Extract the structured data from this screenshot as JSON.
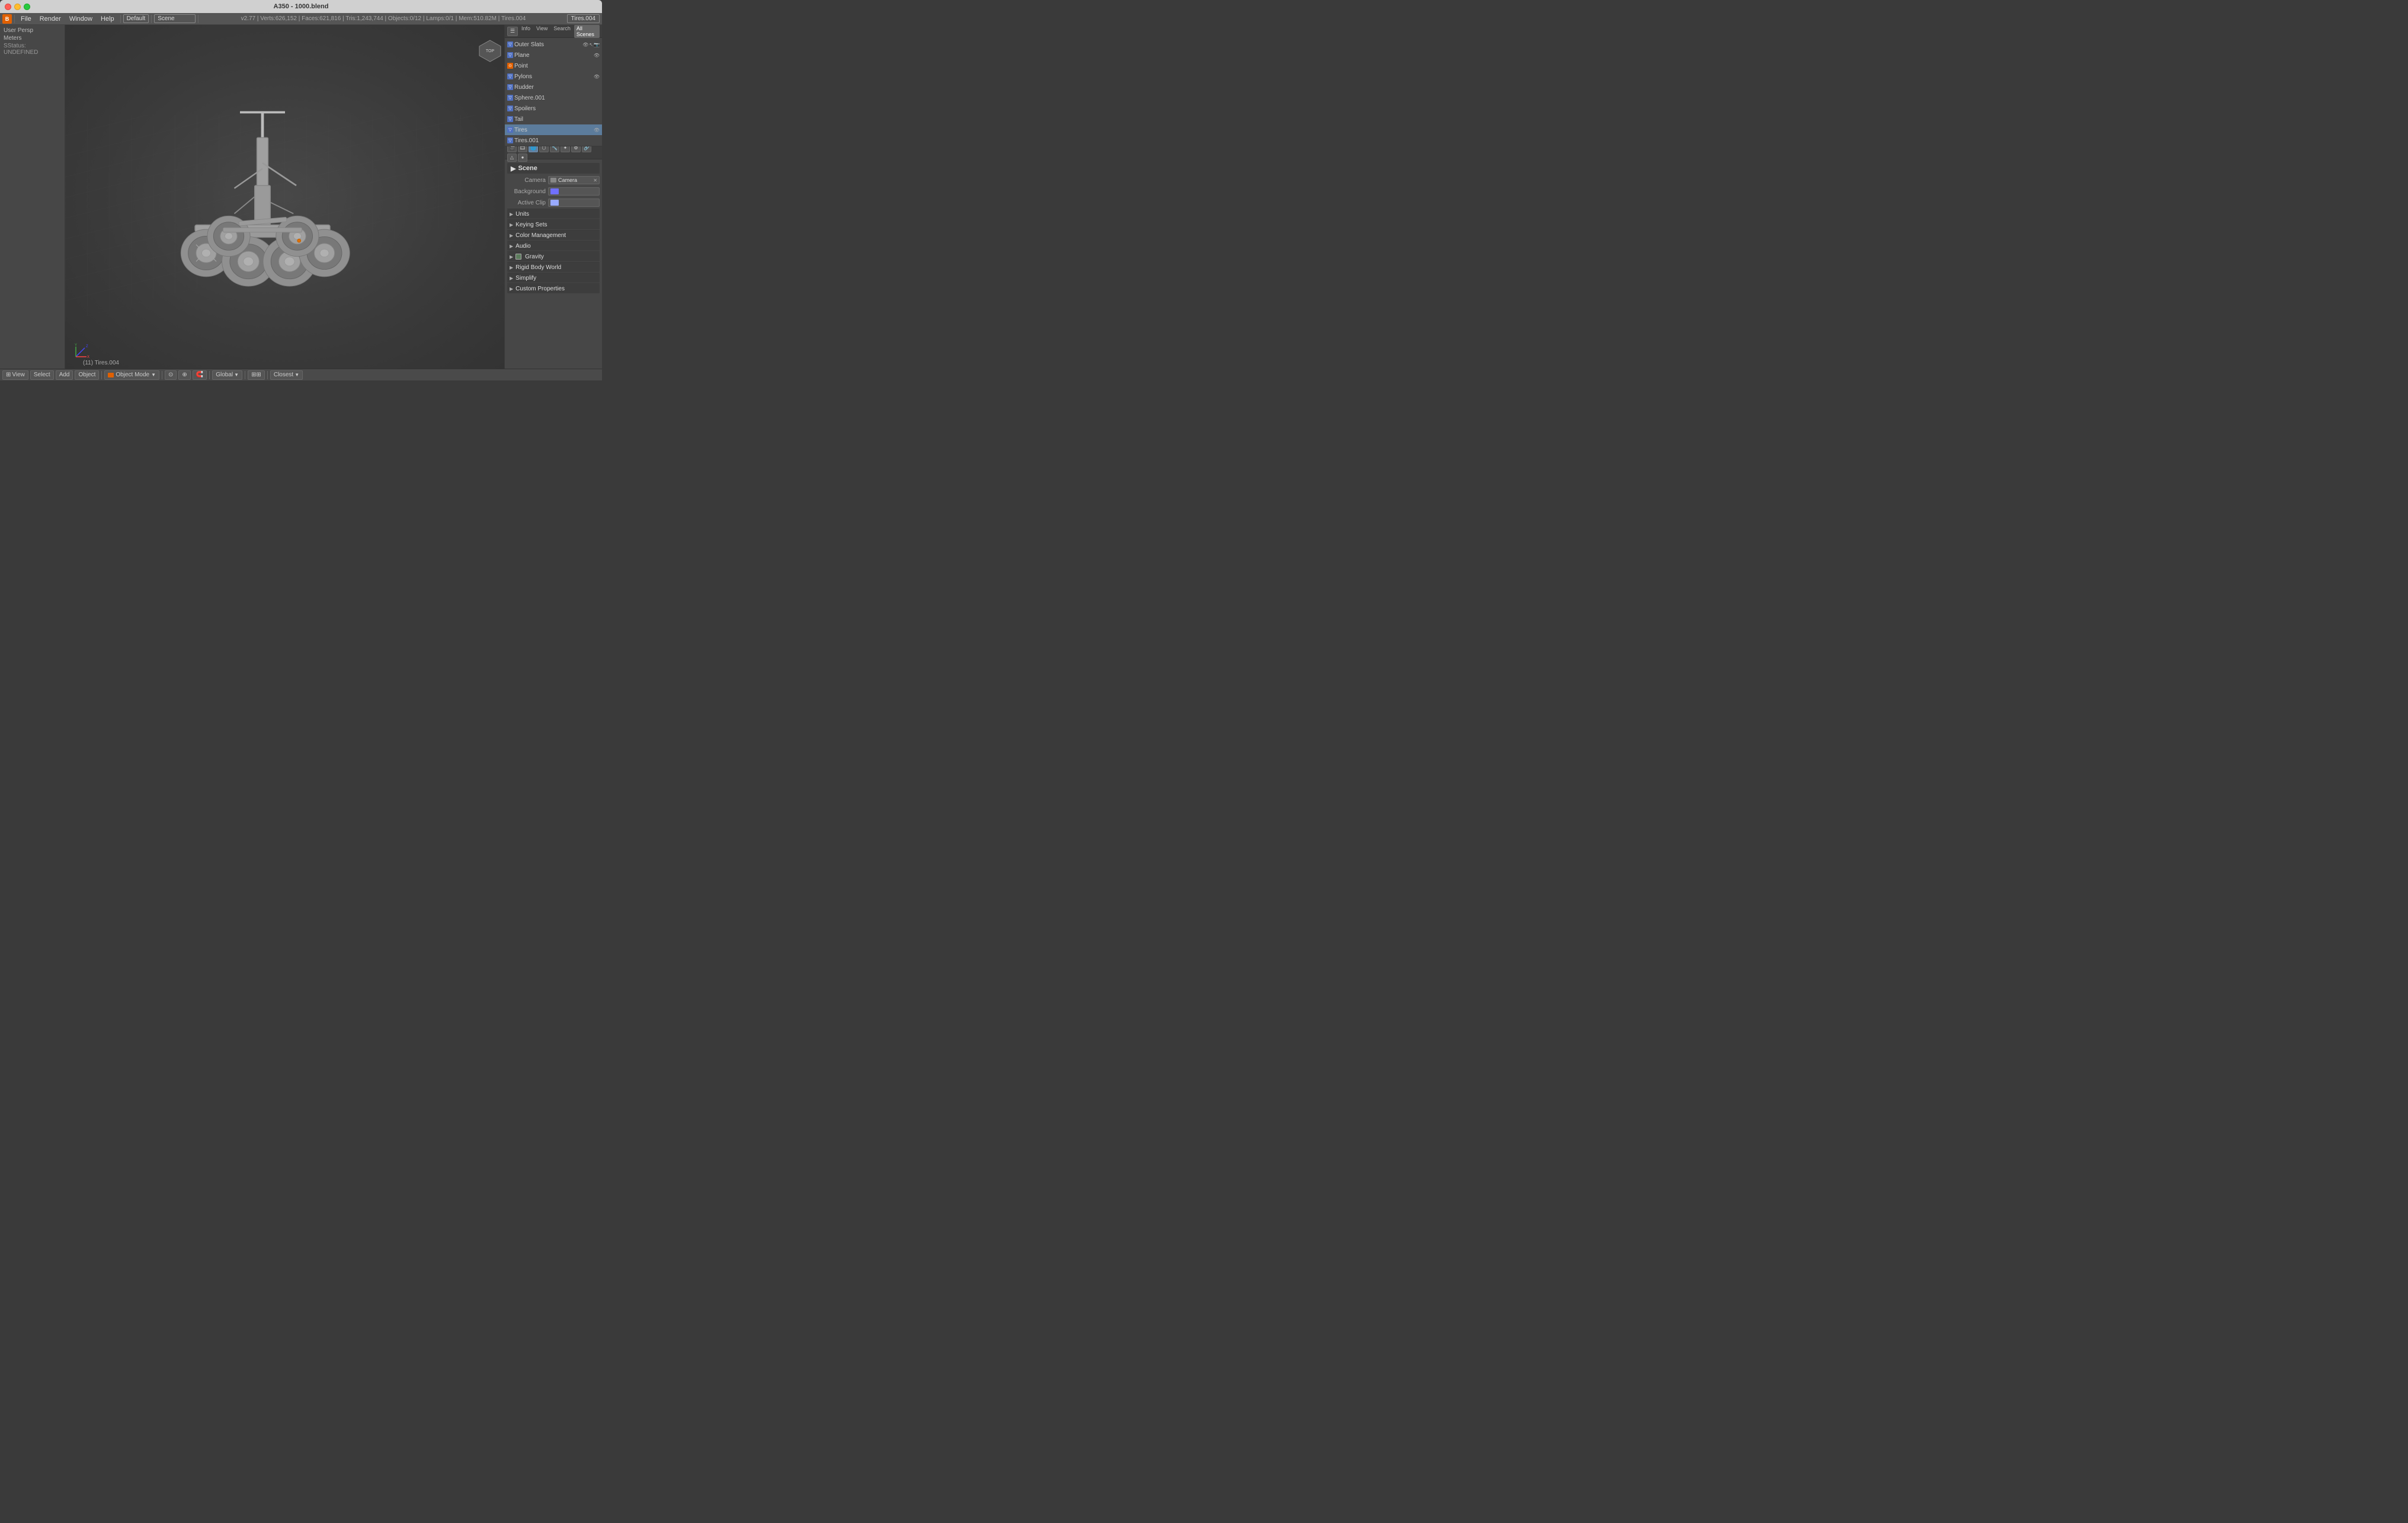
{
  "titlebar": {
    "title": "A350 - 1000.blend"
  },
  "menubar": {
    "blender_icon": "B",
    "items": [
      "File",
      "Render",
      "Window",
      "Help"
    ],
    "layout": "Default",
    "scene": "Scene",
    "stats": "v2.77 | Verts:626,152 | Faces:621,816 | Tris:1,243,744 | Objects:0/12 | Lamps:0/1 | Mem:510.82M | Tires.004",
    "active_object": "Tires.004"
  },
  "left_panel": {
    "view_label": "User Persp",
    "units_label": "Meters",
    "status_label": "SStatus: UNDEFINED"
  },
  "outliner": {
    "header": {
      "tabs": [
        "Info",
        "View",
        "Search",
        "All Scenes"
      ]
    },
    "items": [
      {
        "name": "Outer Slats",
        "type": "mesh",
        "indent": 0
      },
      {
        "name": "Plane",
        "type": "mesh",
        "indent": 0
      },
      {
        "name": "Point",
        "type": "lamp",
        "indent": 0
      },
      {
        "name": "Pylons",
        "type": "mesh",
        "indent": 0
      },
      {
        "name": "Rudder",
        "type": "mesh",
        "indent": 0
      },
      {
        "name": "Sphere.001",
        "type": "mesh",
        "indent": 0
      },
      {
        "name": "Spoilers",
        "type": "mesh",
        "indent": 0
      },
      {
        "name": "Tail",
        "type": "mesh",
        "indent": 0
      },
      {
        "name": "Tires",
        "type": "mesh",
        "indent": 0,
        "selected": true
      },
      {
        "name": "Tires.001",
        "type": "mesh",
        "indent": 0
      }
    ]
  },
  "properties": {
    "scene_title": "Scene",
    "camera_label": "Camera",
    "camera_value": "Camera",
    "background_label": "Background",
    "active_clip_label": "Active Clip",
    "sections": [
      {
        "key": "units",
        "label": "Units",
        "expanded": false
      },
      {
        "key": "keying_sets",
        "label": "Keying Sets",
        "expanded": false
      },
      {
        "key": "color_management",
        "label": "Color Management",
        "expanded": false
      },
      {
        "key": "audio",
        "label": "Audio",
        "expanded": false
      },
      {
        "key": "gravity",
        "label": "Gravity",
        "expanded": false,
        "has_checkbox": true
      },
      {
        "key": "rigid_body_world",
        "label": "Rigid Body World",
        "expanded": false
      },
      {
        "key": "simplify",
        "label": "Simplify",
        "expanded": false
      },
      {
        "key": "custom_properties",
        "label": "Custom Properties",
        "expanded": false
      }
    ]
  },
  "bottom_toolbar": {
    "view_label": "View",
    "select_label": "Select",
    "add_label": "Add",
    "object_label": "Object",
    "mode_label": "Object Mode",
    "global_label": "Global",
    "closest_label": "Closest"
  },
  "viewport": {
    "status_bottom": "(11) Tires.004"
  }
}
